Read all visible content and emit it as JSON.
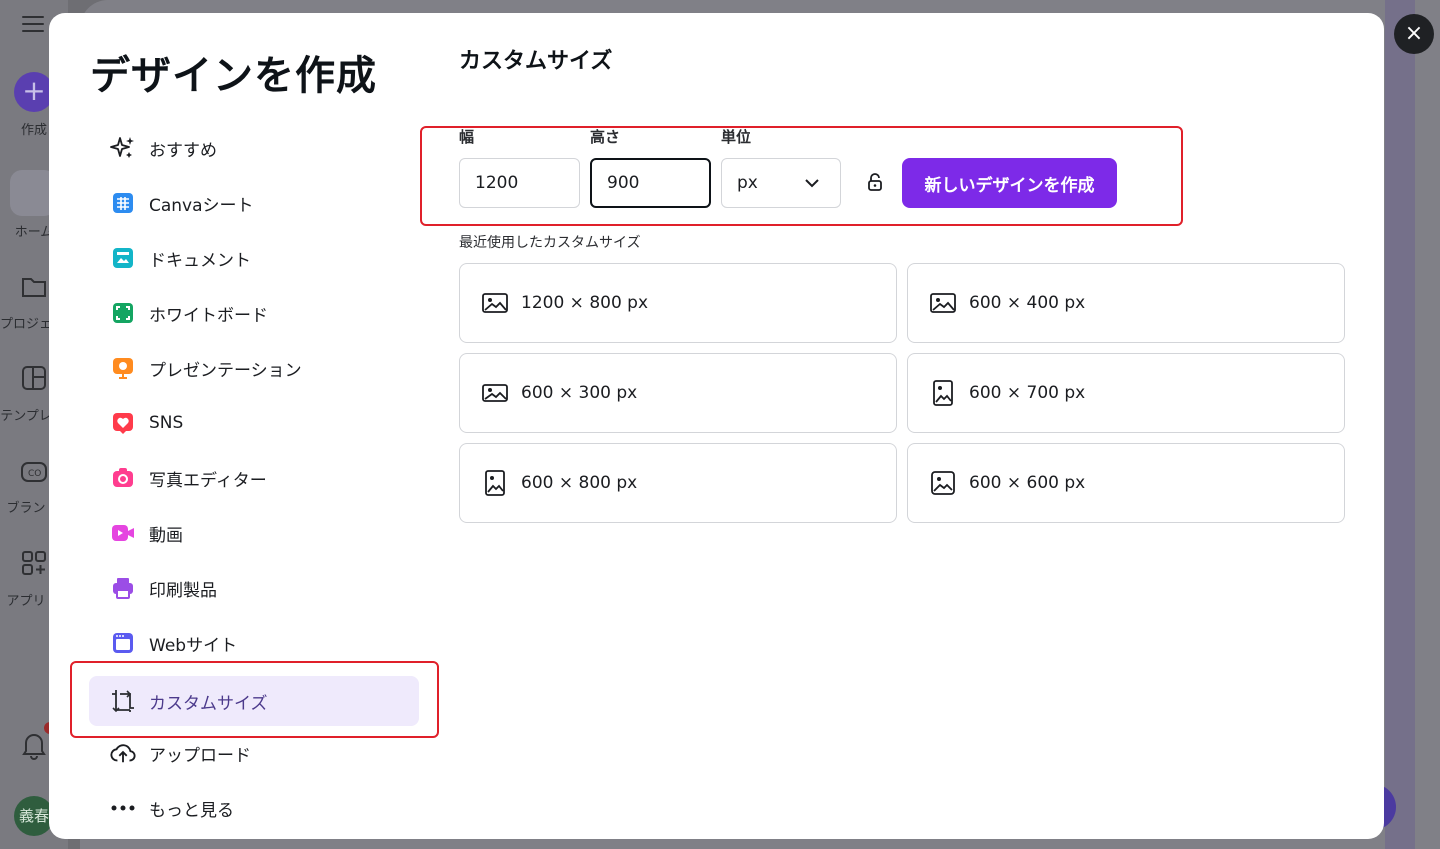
{
  "background": {
    "sidebar": {
      "create_label": "作成",
      "home_label": "ホーム",
      "projects_label": "プロジェ",
      "templates_label": "テンプレ",
      "brand_label": "ブラン",
      "apps_label": "アプリ",
      "avatar_text": "義春"
    }
  },
  "modal": {
    "title": "デザインを作成",
    "close_icon": "×",
    "nav": [
      {
        "label": "おすすめ",
        "icon": "sparkle-icon"
      },
      {
        "label": "Canvaシート",
        "icon": "sheet-icon"
      },
      {
        "label": "ドキュメント",
        "icon": "document-icon"
      },
      {
        "label": "ホワイトボード",
        "icon": "whiteboard-icon"
      },
      {
        "label": "プレゼンテーション",
        "icon": "presentation-icon"
      },
      {
        "label": "SNS",
        "icon": "heart-icon"
      },
      {
        "label": "写真エディター",
        "icon": "camera-icon"
      },
      {
        "label": "動画",
        "icon": "video-icon"
      },
      {
        "label": "印刷製品",
        "icon": "printer-icon"
      },
      {
        "label": "Webサイト",
        "icon": "website-icon"
      },
      {
        "label": "カスタムサイズ",
        "icon": "custom-size-icon",
        "active": true
      },
      {
        "label": "アップロード",
        "icon": "cloud-upload-icon"
      },
      {
        "label": "もっと見る",
        "icon": "more-icon"
      }
    ],
    "custom_size": {
      "section_title": "カスタムサイズ",
      "width_label": "幅",
      "width_value": "1200",
      "height_label": "高さ",
      "height_value": "900",
      "unit_label": "単位",
      "unit_value": "px",
      "create_button": "新しいデザインを作成",
      "recent_label": "最近使用したカスタムサイズ",
      "recent": [
        {
          "text": "1200 × 800 px",
          "orientation": "landscape"
        },
        {
          "text": "600 × 400 px",
          "orientation": "landscape"
        },
        {
          "text": "600 × 300 px",
          "orientation": "landscape"
        },
        {
          "text": "600 × 700 px",
          "orientation": "portrait"
        },
        {
          "text": "600 × 800 px",
          "orientation": "portrait"
        },
        {
          "text": "600 × 600 px",
          "orientation": "square"
        }
      ]
    }
  },
  "colors": {
    "accent": "#7d2ae8",
    "highlight": "#e0202a",
    "active_nav_bg": "#efeafc"
  }
}
